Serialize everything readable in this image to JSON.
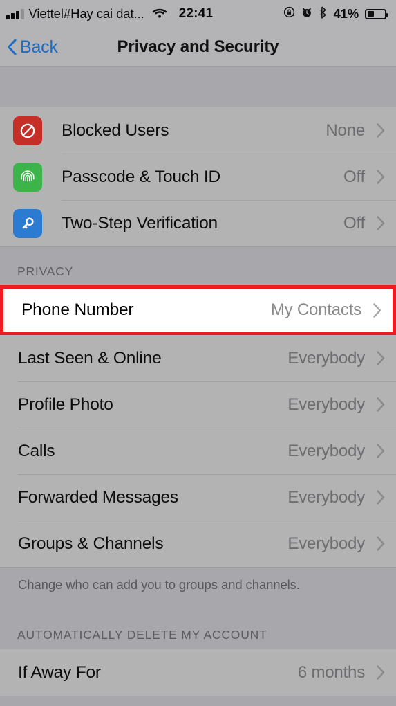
{
  "status_bar": {
    "signal_icon": "signal-bars-icon",
    "signal_bars_filled": 3,
    "carrier": "Viettel#Hay cai dat...",
    "wifi_icon": "wifi-icon",
    "time": "22:41",
    "rotation_lock_icon": "rotation-lock-icon",
    "alarm_icon": "alarm-clock-icon",
    "bluetooth_icon": "bluetooth-icon",
    "battery_percent": "41%",
    "battery_icon": "battery-icon"
  },
  "nav_bar": {
    "back_icon": "chevron-left-icon",
    "back_label": "Back",
    "title": "Privacy and Security"
  },
  "security_section": {
    "rows": [
      {
        "label": "Blocked Users",
        "value": "None",
        "icon": "block-icon",
        "icon_color": "#c62f28",
        "chevron": "chevron-right-icon"
      },
      {
        "label": "Passcode & Touch ID",
        "value": "Off",
        "icon": "fingerprint-icon",
        "icon_color": "#3cb44a",
        "chevron": "chevron-right-icon"
      },
      {
        "label": "Two-Step Verification",
        "value": "Off",
        "icon": "key-icon",
        "icon_color": "#2b7bd3",
        "chevron": "chevron-right-icon"
      }
    ]
  },
  "privacy_section": {
    "header": "PRIVACY",
    "highlighted_row": {
      "label": "Phone Number",
      "value": "My Contacts",
      "chevron": "chevron-right-icon",
      "highlight_color": "#ee1c22"
    },
    "rows": [
      {
        "label": "Last Seen & Online",
        "value": "Everybody",
        "chevron": "chevron-right-icon"
      },
      {
        "label": "Profile Photo",
        "value": "Everybody",
        "chevron": "chevron-right-icon"
      },
      {
        "label": "Calls",
        "value": "Everybody",
        "chevron": "chevron-right-icon"
      },
      {
        "label": "Forwarded Messages",
        "value": "Everybody",
        "chevron": "chevron-right-icon"
      },
      {
        "label": "Groups & Channels",
        "value": "Everybody",
        "chevron": "chevron-right-icon"
      }
    ],
    "footer": "Change who can add you to groups and channels."
  },
  "auto_delete_section": {
    "header": "AUTOMATICALLY DELETE MY ACCOUNT",
    "rows": [
      {
        "label": "If Away For",
        "value": "6 months",
        "chevron": "chevron-right-icon"
      }
    ]
  }
}
